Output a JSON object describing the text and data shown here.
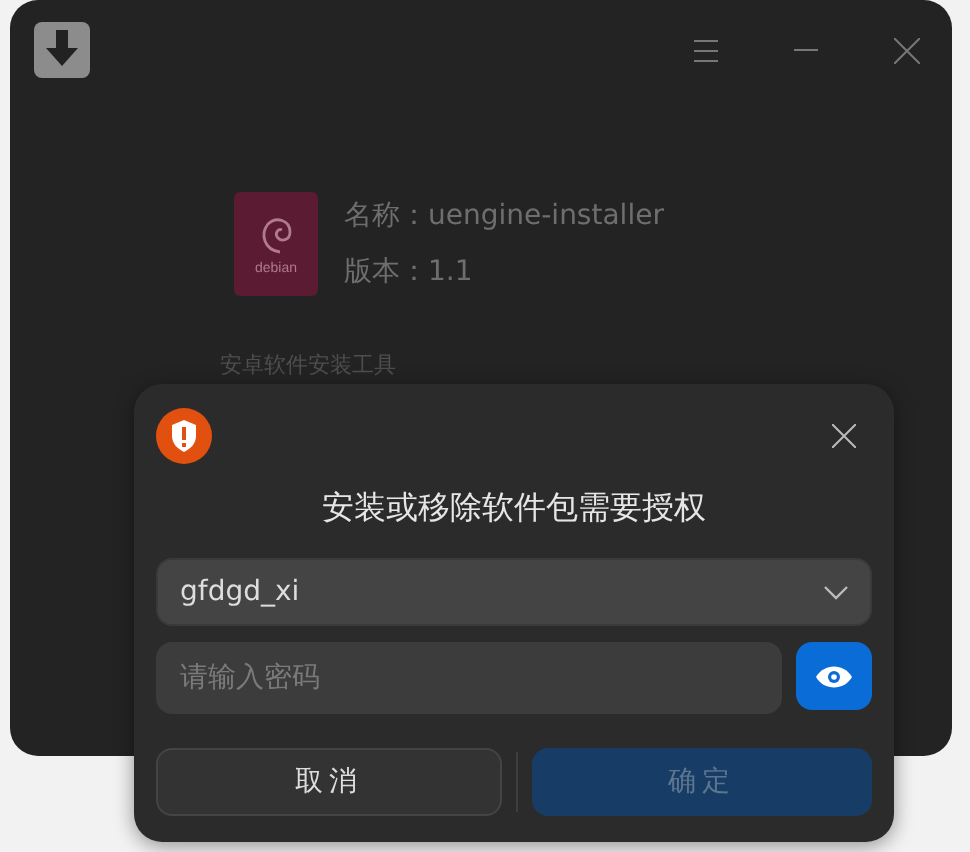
{
  "window": {
    "package": {
      "name_label": "名称：",
      "name": "uengine-installer",
      "version_label": "版本：",
      "version": "1.1",
      "icon_text": "debian"
    },
    "description": "安卓软件安装工具"
  },
  "auth_dialog": {
    "title": "安装或移除软件包需要授权",
    "user": "gfdgd_xi",
    "password": {
      "placeholder": "请输入密码"
    },
    "buttons": [
      {
        "label": "取消",
        "kind": "secondary",
        "disabled": false
      },
      {
        "label": "确定",
        "kind": "primary",
        "disabled": true
      }
    ]
  }
}
